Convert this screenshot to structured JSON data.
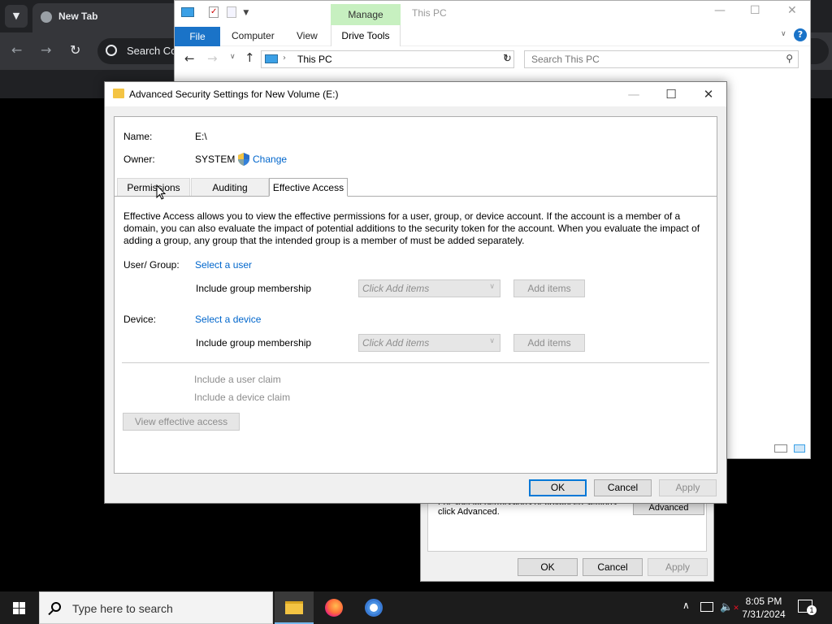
{
  "chrome": {
    "tab_title": "New Tab",
    "omnibox_placeholder": "Search Co"
  },
  "explorer": {
    "manage_tab": "Manage",
    "title": "This PC",
    "ribbon_tabs": [
      "File",
      "Computer",
      "View",
      "Drive Tools"
    ],
    "address_text": "This PC",
    "search_placeholder": "Search This PC"
  },
  "properties": {
    "advanced_text_line1": "For special permissions or advanced settings,",
    "advanced_text_line2": "click Advanced.",
    "advanced_button": "Advanced",
    "ok": "OK",
    "cancel": "Cancel",
    "apply": "Apply"
  },
  "dialog": {
    "title": "Advanced Security Settings for New Volume (E:)",
    "name_label": "Name:",
    "name_value": "E:\\",
    "owner_label": "Owner:",
    "owner_value": "SYSTEM",
    "change_link": "Change",
    "tabs": [
      "Permissions",
      "Auditing",
      "Effective Access"
    ],
    "active_tab": "Effective Access",
    "description": "Effective Access allows you to view the effective permissions for a user, group, or device account. If the account is a member of a domain, you can also evaluate the impact of potential additions to the security token for the account. When you evaluate the impact of adding a group, any group that the intended group is a member of must be added separately.",
    "user_group_label": "User/ Group:",
    "select_user_link": "Select a user",
    "include_group_membership": "Include group membership",
    "click_add_items": "Click Add items",
    "add_items": "Add items",
    "device_label": "Device:",
    "select_device_link": "Select a device",
    "include_user_claim": "Include a user claim",
    "include_device_claim": "Include a device claim",
    "view_effective_access": "View effective access",
    "ok": "OK",
    "cancel": "Cancel",
    "apply": "Apply"
  },
  "taskbar": {
    "search_placeholder": "Type here to search",
    "time": "8:05 PM",
    "date": "7/31/2024",
    "notification_count": "1"
  },
  "colors": {
    "link": "#0066cc",
    "accent": "#0078d7",
    "manage_tab_bg": "#c7f0c0",
    "file_tab_bg": "#1a73c8"
  }
}
